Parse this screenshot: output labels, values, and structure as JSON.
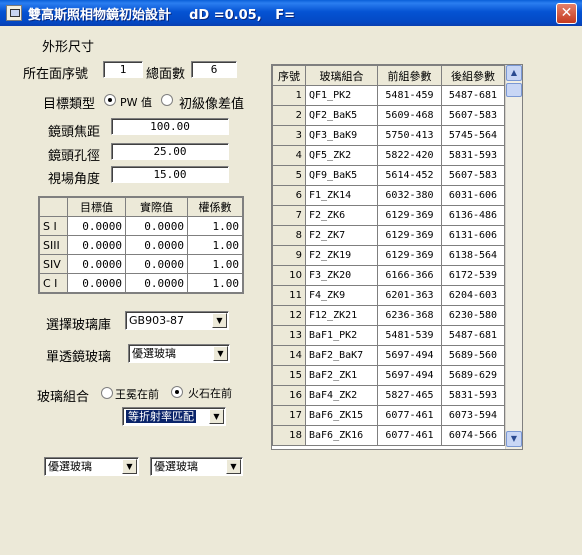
{
  "window": {
    "title": "雙高斯照相物鏡初始設計    dD =0.05,   F=",
    "close_glyph": "✕"
  },
  "shape": {
    "heading": "外形尺寸",
    "surface_index_label": "所在面序號",
    "surface_index_value": "1",
    "total_surfaces_label": "總面數",
    "total_surfaces_value": "6"
  },
  "target": {
    "type_label": "目標類型",
    "option_pw": "PW 值",
    "option_aberr": "初級像差值",
    "focal_label": "鏡頭焦距",
    "focal_value": "100.00",
    "aperture_label": "鏡頭孔徑",
    "aperture_value": "25.00",
    "fov_label": "視場角度",
    "fov_value": "15.00"
  },
  "coef_grid": {
    "headers": [
      "",
      "目標值",
      "實際值",
      "權係數"
    ],
    "rows": [
      {
        "name": "S I",
        "target": "0.0000",
        "actual": "0.0000",
        "weight": "1.00"
      },
      {
        "name": "SIII",
        "target": "0.0000",
        "actual": "0.0000",
        "weight": "1.00"
      },
      {
        "name": "SIV",
        "target": "0.0000",
        "actual": "0.0000",
        "weight": "1.00"
      },
      {
        "name": "C I",
        "target": "0.0000",
        "actual": "0.0000",
        "weight": "1.00"
      }
    ]
  },
  "glass_lib": {
    "label": "選擇玻璃庫",
    "value": "GB903-87"
  },
  "single_lens": {
    "label": "單透鏡玻璃",
    "value": "優選玻璃"
  },
  "combo": {
    "label": "玻璃組合",
    "option_crown_front": "王冕在前",
    "option_flint_front": "火石在前",
    "match_value": "等折射率匹配"
  },
  "bottom": {
    "left_value": "優選玻璃",
    "right_value": "優選玻璃"
  },
  "glass_table": {
    "headers": [
      "序號",
      "玻璃組合",
      "前組參數",
      "後組參數"
    ],
    "rows": [
      {
        "no": "1",
        "glass": "QF1_PK2",
        "front": "5481-459",
        "rear": "5487-681"
      },
      {
        "no": "2",
        "glass": "QF2_BaK5",
        "front": "5609-468",
        "rear": "5607-583"
      },
      {
        "no": "3",
        "glass": "QF3_BaK9",
        "front": "5750-413",
        "rear": "5745-564"
      },
      {
        "no": "4",
        "glass": "QF5_ZK2",
        "front": "5822-420",
        "rear": "5831-593"
      },
      {
        "no": "5",
        "glass": "QF9_BaK5",
        "front": "5614-452",
        "rear": "5607-583"
      },
      {
        "no": "6",
        "glass": "F1_ZK14",
        "front": "6032-380",
        "rear": "6031-606"
      },
      {
        "no": "7",
        "glass": "F2_ZK6",
        "front": "6129-369",
        "rear": "6136-486"
      },
      {
        "no": "8",
        "glass": "F2_ZK7",
        "front": "6129-369",
        "rear": "6131-606"
      },
      {
        "no": "9",
        "glass": "F2_ZK19",
        "front": "6129-369",
        "rear": "6138-564"
      },
      {
        "no": "10",
        "glass": "F3_ZK20",
        "front": "6166-366",
        "rear": "6172-539"
      },
      {
        "no": "11",
        "glass": "F4_ZK9",
        "front": "6201-363",
        "rear": "6204-603"
      },
      {
        "no": "12",
        "glass": "F12_ZK21",
        "front": "6236-368",
        "rear": "6230-580"
      },
      {
        "no": "13",
        "glass": "BaF1_PK2",
        "front": "5481-539",
        "rear": "5487-681"
      },
      {
        "no": "14",
        "glass": "BaF2_BaK7",
        "front": "5697-494",
        "rear": "5689-560"
      },
      {
        "no": "15",
        "glass": "BaF2_ZK1",
        "front": "5697-494",
        "rear": "5689-629"
      },
      {
        "no": "16",
        "glass": "BaF4_ZK2",
        "front": "5827-465",
        "rear": "5831-593"
      },
      {
        "no": "17",
        "glass": "BaF6_ZK15",
        "front": "6077-461",
        "rear": "6073-594"
      },
      {
        "no": "18",
        "glass": "BaF6_ZK16",
        "front": "6077-461",
        "rear": "6074-566"
      }
    ]
  }
}
